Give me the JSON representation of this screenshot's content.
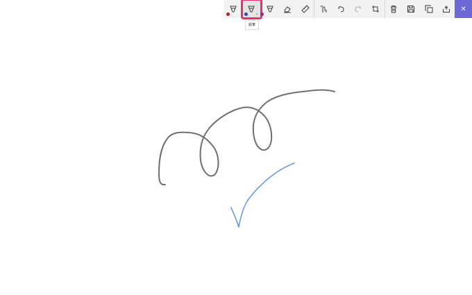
{
  "toolbar": {
    "tools": [
      {
        "name": "ballpoint-pen",
        "icon": "ballpoint-pen-icon",
        "dot_color": "#b3202a"
      },
      {
        "name": "pencil",
        "icon": "pencil-icon",
        "dot_color": "#2c4aa0",
        "selected": true
      },
      {
        "name": "highlighter",
        "icon": "highlighter-icon",
        "dot_color": "#a0258f"
      },
      {
        "name": "eraser",
        "icon": "eraser-icon"
      },
      {
        "name": "ruler",
        "icon": "ruler-icon"
      },
      {
        "name": "touch-writing",
        "icon": "touch-writing-icon"
      },
      {
        "name": "undo",
        "icon": "undo-icon"
      },
      {
        "name": "redo",
        "icon": "redo-icon"
      },
      {
        "name": "crop",
        "icon": "crop-icon"
      },
      {
        "name": "delete",
        "icon": "trash-icon"
      },
      {
        "name": "save",
        "icon": "save-icon"
      },
      {
        "name": "copy",
        "icon": "copy-icon"
      },
      {
        "name": "share",
        "icon": "share-icon"
      },
      {
        "name": "close",
        "icon": "close-icon",
        "glyph": "✕"
      }
    ],
    "accent": "#6b69d6",
    "highlight": "#ec2f6a"
  },
  "tooltip": {
    "text": "鉛筆"
  },
  "strokes": {
    "pencil_color": "#6f6f6f",
    "ink_color": "#6a9ae0"
  }
}
